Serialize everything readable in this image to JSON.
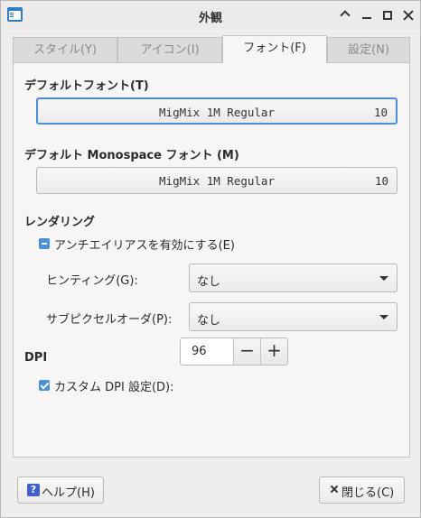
{
  "window": {
    "title": "外観"
  },
  "tabs": [
    {
      "label": "スタイル(Y)"
    },
    {
      "label": "アイコン(I)"
    },
    {
      "label": "フォント(F)"
    },
    {
      "label": "設定(N)"
    }
  ],
  "active_tab": "フォント(F)",
  "fonts": {
    "default_title": "デフォルトフォント(T)",
    "default_font_name": "MigMix 1M Regular",
    "default_font_size": "10",
    "mono_title": "デフォルト Monospace フォント (M)",
    "mono_font_name": "MigMix 1M Regular",
    "mono_font_size": "10"
  },
  "rendering": {
    "title": "レンダリング",
    "antialias_label": "アンチエイリアスを有効にする(E)",
    "antialias_state": "indeterminate",
    "hinting_label": "ヒンティング(G):",
    "hinting_value": "なし",
    "subpixel_label": "サブピクセルオーダ(P):",
    "subpixel_value": "なし"
  },
  "dpi": {
    "title": "DPI",
    "custom_label": "カスタム DPI 設定(D):",
    "custom_checked": true,
    "value": "96",
    "minus": "−",
    "plus": "+"
  },
  "buttons": {
    "help": "ヘルプ(H)",
    "help_icon_glyph": "?",
    "close": "閉じる(C)"
  },
  "colors": {
    "accent": "#4a90d9",
    "window_bg": "#efeeed"
  }
}
